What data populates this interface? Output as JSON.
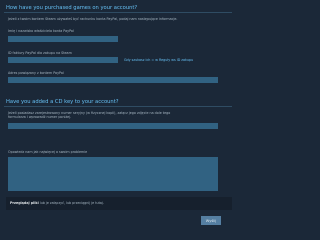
{
  "section1": {
    "title": "How have you purchased games on your account?",
    "intro": "Jeżeli z twoim kontem Steam używałeś być rachunku konta PayPal, podaj nam następujące informacje.",
    "paypal_email_label": "Imię i nazwisko właściciela konta PayPal",
    "paypal_id_label": "ID faktury PayPal dla zakupu na Steam",
    "paypal_id_help_link": "Gdy szukasz ich = w Reguły ws ID zakupu",
    "address_label": "Adres powiązany z kontem PayPal"
  },
  "section2": {
    "title": "Have you added a CD key to your account?",
    "intro_line1": "Jeżeli posiadasz zarejestrowany numer seryjny (w fizycznej kopii), załącz jego zdjęcie na dole tego",
    "intro_line2": "formularza i wprowadź numer poniżej.",
    "description_label": "Opowiedz nam jak najwięcej o swoim problemie"
  },
  "note": {
    "prefix": "Przeglądaj pliki",
    "text": "lub je załączyć, lub przeciągnij je tutaj."
  },
  "submit_label": "Wyślij"
}
